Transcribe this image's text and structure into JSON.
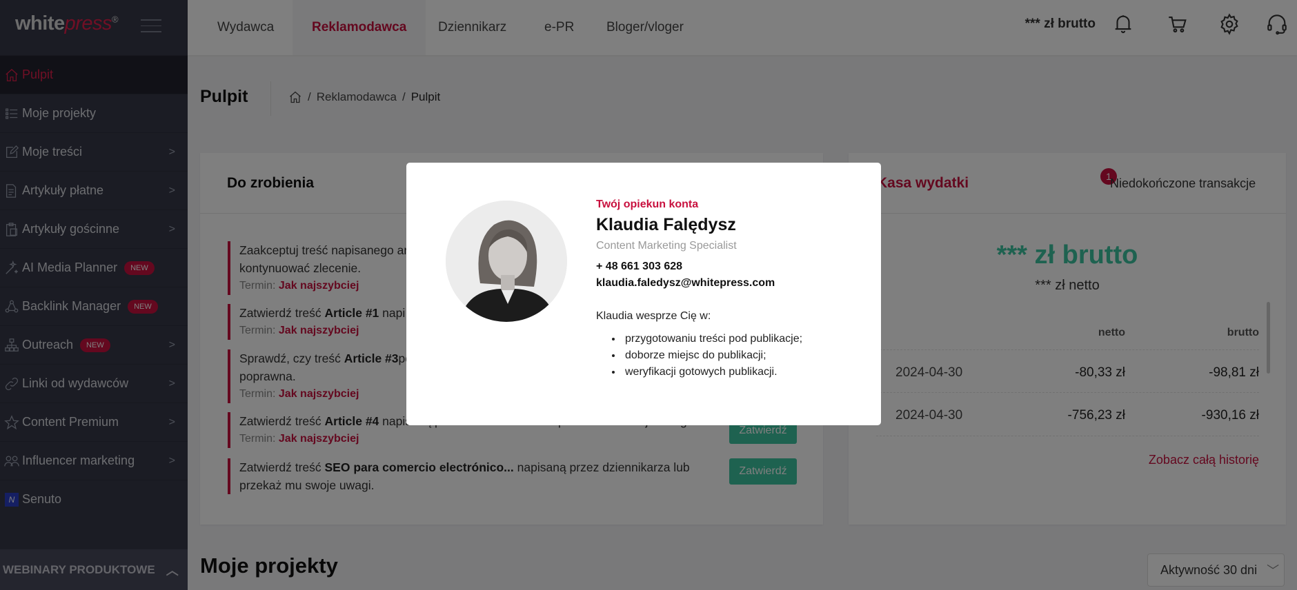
{
  "brand": {
    "logo_white": "white",
    "logo_press": "press",
    "logo_mark": "®",
    "accent": "#c8103e",
    "green": "#3cc4a0"
  },
  "header": {
    "tabs": [
      {
        "label": "Wydawca"
      },
      {
        "label": "Reklamodawca",
        "active": true
      },
      {
        "label": "Dziennikarz"
      },
      {
        "label": "e-PR"
      },
      {
        "label": "Bloger/vloger"
      }
    ],
    "balance": "*** zł brutto",
    "icons": [
      "bell-icon",
      "cart-icon",
      "gear-icon",
      "headset-icon"
    ]
  },
  "sidebar": {
    "items": [
      {
        "label": "Pulpit",
        "icon": "home-icon",
        "active": true
      },
      {
        "label": "Moje projekty",
        "icon": "list-icon"
      },
      {
        "label": "Moje treści",
        "icon": "edit-icon",
        "chevron": true
      },
      {
        "label": "Artykuły płatne",
        "icon": "paid-document-icon",
        "chevron": true
      },
      {
        "label": "Artykuły gościnne",
        "icon": "clipboard-icon",
        "chevron": true
      },
      {
        "label": "AI Media Planner",
        "icon": "magic-wand-icon",
        "badge": "NEW"
      },
      {
        "label": "Backlink Manager",
        "icon": "network-icon",
        "badge": "NEW"
      },
      {
        "label": "Outreach",
        "icon": "sitemap-icon",
        "badge": "NEW",
        "chevron": true
      },
      {
        "label": "Linki od wydawców",
        "icon": "link-icon",
        "chevron": true
      },
      {
        "label": "Content Premium",
        "icon": "star-icon",
        "chevron": true
      },
      {
        "label": "Influencer marketing",
        "icon": "users-icon",
        "chevron": true
      },
      {
        "label": "Senuto",
        "icon": "senuto-icon",
        "icon_text": "N"
      }
    ],
    "webinar": "WEBINARY PRODUKTOWE"
  },
  "page": {
    "title": "Pulpit",
    "breadcrumb": [
      "Reklamodawca",
      "Pulpit"
    ]
  },
  "todo": {
    "title": "Do zrobienia",
    "term_label": "Termin:",
    "term_value": "Jak najszybciej",
    "approve_label": "Zatwierdź",
    "tasks": [
      {
        "pre": "Zaakceptuj treść napisanego ar",
        "bold": "",
        "post": "",
        "line2": "kontynuować zlecenie.",
        "term": true
      },
      {
        "pre": "Zatwierdź treść ",
        "bold": "Article #1",
        "post": " napi",
        "line2": "",
        "term": true
      },
      {
        "pre": "Sprawdź, czy treść ",
        "bold": "Article #3",
        "post": "po",
        "line2": "poprawna.",
        "term": true
      },
      {
        "pre": "Zatwierdź treść ",
        "bold": "Article #4",
        "post": " napisaną przez dziennikarza lub przekaż mu swoje uwagi.",
        "line2": "",
        "term": true
      },
      {
        "pre": "Zatwierdź treść ",
        "bold": "SEO para comercio electrónico...",
        "post": " napisaną przez dziennikarza lub",
        "line2": "przekaż mu swoje uwagi.",
        "term": false
      }
    ]
  },
  "kasa": {
    "title": "Kasa wydatki",
    "badge": "1",
    "unfinished": "Niedokończone transakcje",
    "brutto": "*** zł brutto",
    "netto": "*** zł netto",
    "columns": [
      "netto",
      "brutto"
    ],
    "rows": [
      {
        "date": "2024-04-30",
        "netto": "-80,33 zł",
        "brutto": "-98,81 zł"
      },
      {
        "date": "2024-04-30",
        "netto": "-756,23 zł",
        "brutto": "-930,16 zł"
      }
    ],
    "history_link": "Zobacz całą historię"
  },
  "projects": {
    "title": "Moje projekty",
    "filter": "Aktywność 30 dni"
  },
  "modal": {
    "label": "Twój opiekun konta",
    "name": "Klaudia Falędysz",
    "role": "Content Marketing Specialist",
    "phone": "+ 48 661 303 628",
    "email": "klaudia.faledysz@whitepress.com",
    "intro": "Klaudia wesprze Cię w:",
    "items": [
      "przygotowaniu treści pod publikacje;",
      "doborze miejsc do publikacji;",
      "weryfikacji gotowych publikacji."
    ]
  }
}
